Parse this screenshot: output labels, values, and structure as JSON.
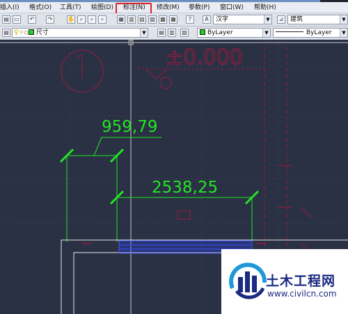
{
  "menu": [
    {
      "label": "插入(I)"
    },
    {
      "label": "格式(O)"
    },
    {
      "label": "工具(T)"
    },
    {
      "label": "绘图(D)"
    },
    {
      "label": "标注(N)"
    },
    {
      "label": "修改(M)"
    },
    {
      "label": "参数(P)"
    },
    {
      "label": "窗口(W)"
    },
    {
      "label": "帮助(H)"
    }
  ],
  "highlighted_menu": "标注(N)",
  "colors": {
    "drawing_bg": "#2a3144",
    "dimension": "#22e622",
    "outline": "#e8e8e8",
    "hatch": "#2b3fd6",
    "marker": "#c0143a",
    "highlight_box": "#d6262a"
  },
  "toolbar": {
    "text_style": "汉字",
    "dim_style": "建筑",
    "layer": "尺寸",
    "color": "ByLayer",
    "linetype": "ByLayer"
  },
  "drawing": {
    "dim_short": "959,79",
    "dim_long": "2538,25",
    "elevation": "±0.000"
  },
  "watermark": {
    "name": "土木工程网",
    "url": "www.civilcn.com"
  }
}
